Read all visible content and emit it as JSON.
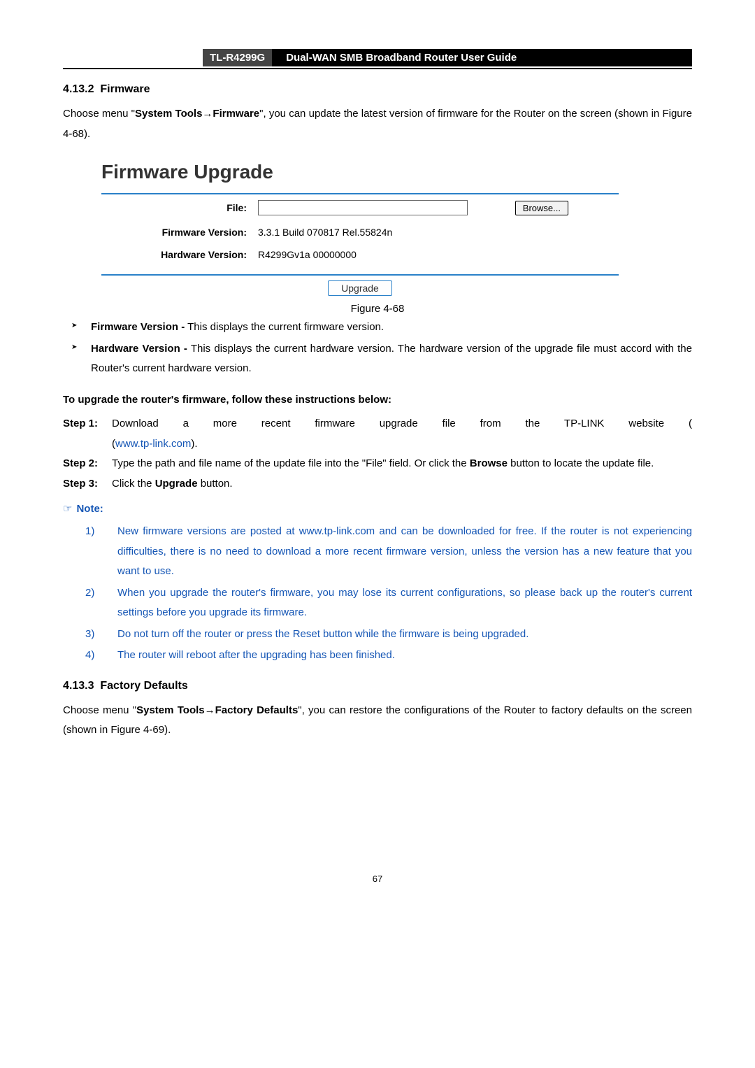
{
  "header": {
    "model": "TL-R4299G",
    "title": "Dual-WAN SMB Broadband Router User Guide"
  },
  "section1": {
    "number": "4.13.2",
    "title": "Firmware",
    "intro_pre": "Choose menu \"",
    "intro_bold": "System Tools→Firmware",
    "intro_post": "\", you can update the latest version of firmware for the Router on the screen (shown in Figure 4-68)."
  },
  "firmware_box": {
    "heading": "Firmware Upgrade",
    "file_label": "File:",
    "file_value": "",
    "browse_label": "Browse...",
    "fw_version_label": "Firmware Version:",
    "fw_version_value": "3.3.1 Build 070817 Rel.55824n",
    "hw_version_label": "Hardware Version:",
    "hw_version_value": "R4299Gv1a 00000000",
    "upgrade_label": "Upgrade"
  },
  "figure_caption": "Figure 4-68",
  "bullets": {
    "b1_bold": "Firmware Version -",
    "b1_text": " This displays the current firmware version.",
    "b2_bold": "Hardware Version -",
    "b2_text": " This displays the current hardware version. The hardware version of the upgrade file must accord with the Router's current hardware version."
  },
  "instructions_heading": "To upgrade the router's firmware, follow these instructions below:",
  "steps": {
    "s1_label": "Step 1:",
    "s1_a": "Download a more recent firmware upgrade file from the TP-LINK website (",
    "s1_link": "www.tp-link.com",
    "s1_b": ").",
    "s2_label": "Step 2:",
    "s2_a": "Type the path and file name of the update file into the \"File\" field. Or click the ",
    "s2_bold": "Browse",
    "s2_b": " button to locate the update file.",
    "s3_label": "Step 3:",
    "s3_a": "Click the ",
    "s3_bold": "Upgrade",
    "s3_b": " button."
  },
  "note": {
    "hand": "☞",
    "label": "Note:",
    "n1_num": "1)",
    "n1_a": "New firmware versions are posted at ",
    "n1_link": "www.tp-link.com",
    "n1_b": " and can be downloaded for free. If the router is not experiencing difficulties, there is no need to download a more recent firmware version, unless the version has a new feature that you want to use.",
    "n2_num": "2)",
    "n2": "When you upgrade the router's firmware, you may lose its current configurations, so please back up the router's current settings before you upgrade its firmware.",
    "n3_num": "3)",
    "n3": "Do not turn off the router or press the Reset button while the firmware is being upgraded.",
    "n4_num": "4)",
    "n4": "The router will reboot after the upgrading has been finished."
  },
  "section2": {
    "number": "4.13.3",
    "title": "Factory Defaults",
    "intro_pre": "Choose menu \"",
    "intro_bold": "System Tools→Factory Defaults",
    "intro_post": "\", you can restore the configurations of the Router to factory defaults on the screen (shown in Figure 4-69)."
  },
  "page_number": "67"
}
